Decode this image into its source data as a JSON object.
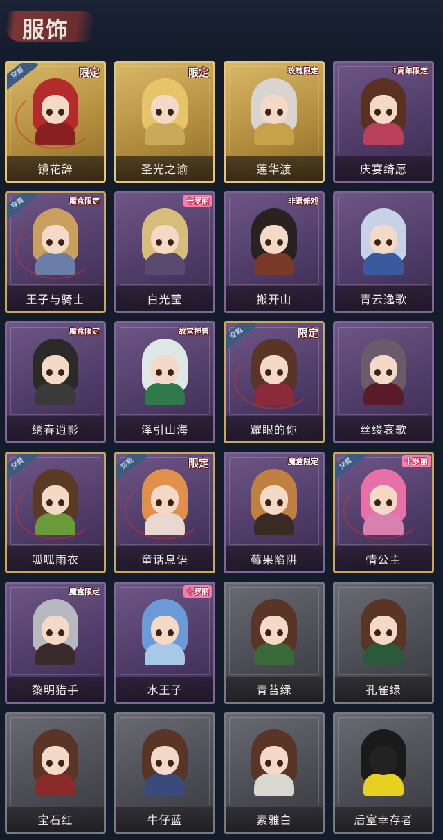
{
  "header": {
    "title": "服饰"
  },
  "colors": {
    "background": "#141b2b",
    "gold_frame": "#d9b868",
    "purple_frame": "#6e5686",
    "gray_frame": "#6a6a72"
  },
  "costumes": [
    {
      "name": "镜花辞",
      "frame": "gold",
      "tag": "限定",
      "owned": true,
      "owned_label": "穿戴",
      "hair": "#b52a2a",
      "cloth": "#8a1f1f"
    },
    {
      "name": "圣光之谕",
      "frame": "gold",
      "tag": "限定",
      "owned": false,
      "hair": "#e6c56a",
      "cloth": "#c9a95a"
    },
    {
      "name": "莲华渡",
      "frame": "gold",
      "tag": "玫瑰限定",
      "owned": false,
      "hair": "#d8d4d0",
      "cloth": "#c9a14a"
    },
    {
      "name": "庆宴绮愿",
      "frame": "purple",
      "tag": "1周年限定",
      "owned": false,
      "hair": "#5a3020",
      "cloth": "#b8405a"
    },
    {
      "name": "王子与骑士",
      "frame": "purple",
      "tag": "魔盒限定",
      "owned": true,
      "owned_label": "穿戴",
      "hair": "#c9a060",
      "cloth": "#6a7ea8"
    },
    {
      "name": "白光莹",
      "frame": "purple",
      "tag": "十罗丽",
      "tag_style": "pink",
      "owned": false,
      "hair": "#d8bc7a",
      "cloth": "#5a4a70"
    },
    {
      "name": "搬开山",
      "frame": "purple",
      "tag": "非遗傩戏",
      "owned": false,
      "hair": "#2a2220",
      "cloth": "#7a3a2a"
    },
    {
      "name": "青云逸歌",
      "frame": "purple",
      "tag": "",
      "owned": false,
      "hair": "#c8d2e6",
      "cloth": "#3a5aa0"
    },
    {
      "name": "绣春逍影",
      "frame": "purple",
      "tag": "魔盒限定",
      "owned": false,
      "hair": "#2c2a28",
      "cloth": "#3a3a3a"
    },
    {
      "name": "泽引山海",
      "frame": "purple",
      "tag": "故宫神兽",
      "owned": false,
      "hair": "#dfe6e6",
      "cloth": "#2e7a4a"
    },
    {
      "name": "耀眼的你",
      "frame": "purple",
      "tag": "限定",
      "owned": true,
      "owned_label": "穿戴",
      "hair": "#5a3424",
      "cloth": "#8a2a3a"
    },
    {
      "name": "丝缕哀歌",
      "frame": "purple",
      "tag": "",
      "owned": false,
      "hair": "#6a5a6a",
      "cloth": "#5a1a2a"
    },
    {
      "name": "呱呱雨衣",
      "frame": "purple",
      "tag": "",
      "owned": true,
      "owned_label": "穿戴",
      "hair": "#5a3a24",
      "cloth": "#6a9a3a"
    },
    {
      "name": "童话息语",
      "frame": "purple",
      "tag": "限定",
      "owned": true,
      "owned_label": "穿戴",
      "hair": "#e0904a",
      "cloth": "#e8d8d0"
    },
    {
      "name": "莓果陷阱",
      "frame": "purple",
      "tag": "魔盒限定",
      "owned": false,
      "hair": "#c08040",
      "cloth": "#3a2a24"
    },
    {
      "name": "情公主",
      "frame": "purple",
      "tag": "十罗丽",
      "tag_style": "pink",
      "owned": true,
      "owned_label": "穿戴",
      "hair": "#e870a8",
      "cloth": "#d880b0"
    },
    {
      "name": "黎明猎手",
      "frame": "purple",
      "tag": "魔盒限定",
      "owned": false,
      "hair": "#b8b8c0",
      "cloth": "#3a2a2a"
    },
    {
      "name": "水王子",
      "frame": "purple",
      "tag": "十罗丽",
      "tag_style": "pink",
      "owned": false,
      "hair": "#6a9ad8",
      "cloth": "#a8c8e8"
    },
    {
      "name": "青苔绿",
      "frame": "gray",
      "tag": "",
      "owned": false,
      "hair": "#5a3424",
      "cloth": "#3a6a3a"
    },
    {
      "name": "孔雀绿",
      "frame": "gray",
      "tag": "",
      "owned": false,
      "hair": "#5a3424",
      "cloth": "#2a5a3a"
    },
    {
      "name": "宝石红",
      "frame": "gray",
      "tag": "",
      "owned": false,
      "hair": "#5a3424",
      "cloth": "#8a2a2a"
    },
    {
      "name": "牛仔蓝",
      "frame": "gray",
      "tag": "",
      "owned": false,
      "hair": "#5a3424",
      "cloth": "#3a4a7a"
    },
    {
      "name": "素雅白",
      "frame": "gray",
      "tag": "",
      "owned": false,
      "hair": "#5a3424",
      "cloth": "#d8d8d0"
    },
    {
      "name": "后室幸存者",
      "frame": "gray",
      "tag": "",
      "owned": false,
      "hair": "#1a1a1a",
      "cloth": "#e8d020",
      "face": "#222222"
    }
  ]
}
